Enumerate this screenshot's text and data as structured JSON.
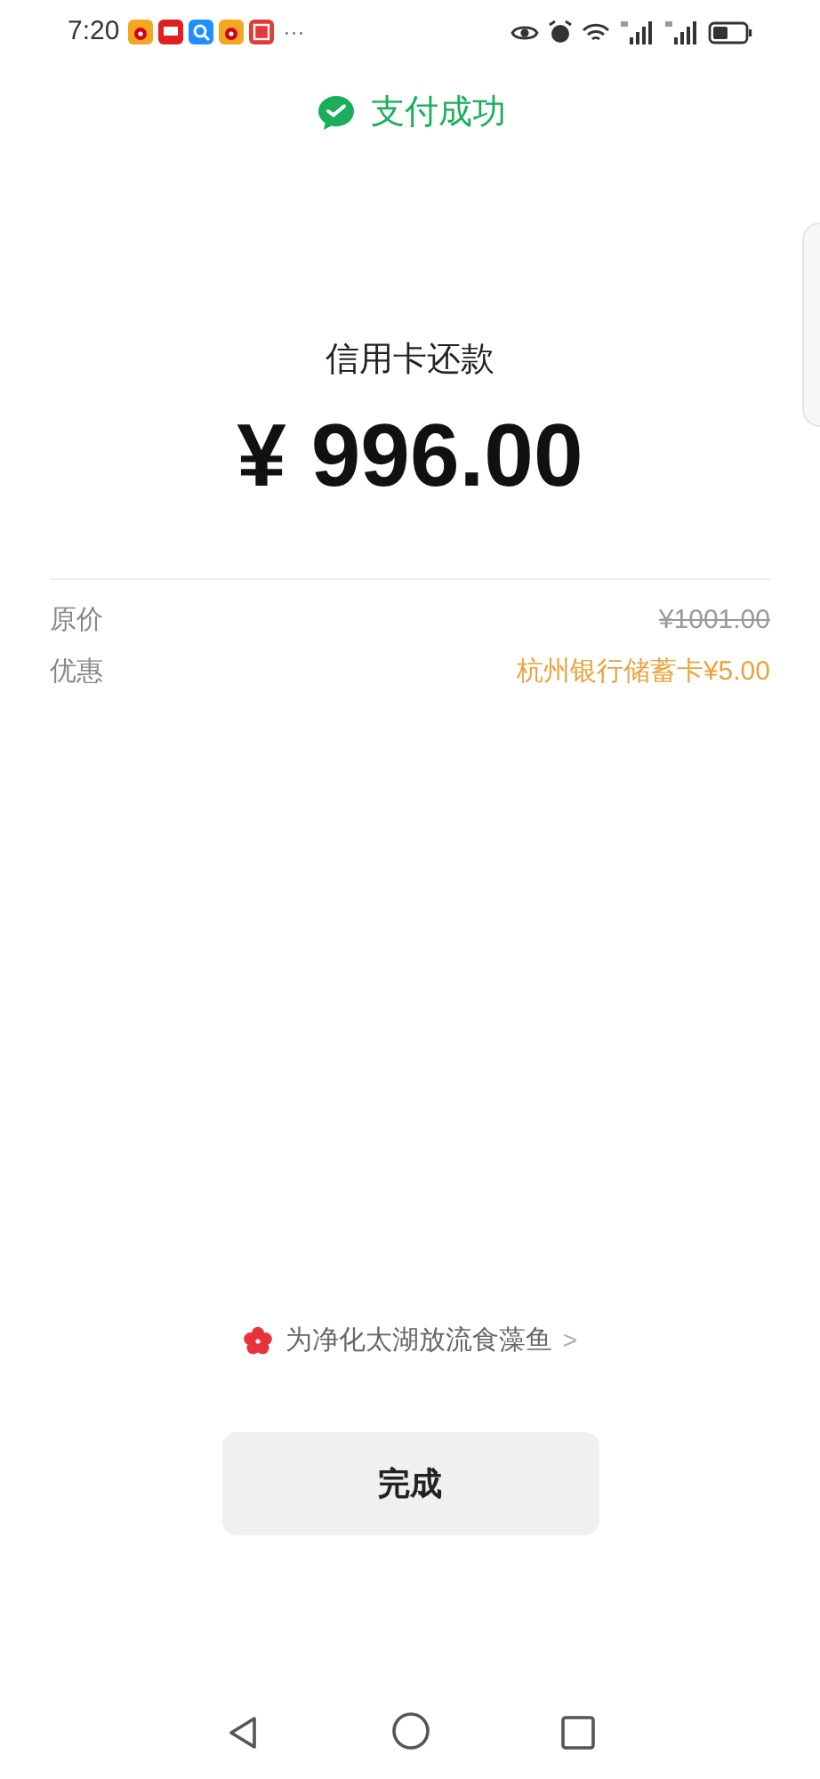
{
  "status_bar": {
    "time": "7:20",
    "more": "···"
  },
  "header": {
    "title": "支付成功"
  },
  "payment": {
    "label": "信用卡还款",
    "amount": "¥ 996.00"
  },
  "details": [
    {
      "kind": "strike",
      "label": "原价",
      "value": "¥1001.00"
    },
    {
      "kind": "discount",
      "label": "优惠",
      "value": "杭州银行储蓄卡¥5.00"
    }
  ],
  "promo": {
    "text": "为净化太湖放流食藻鱼",
    "chevron": ">"
  },
  "done_button": {
    "label": "完成"
  }
}
